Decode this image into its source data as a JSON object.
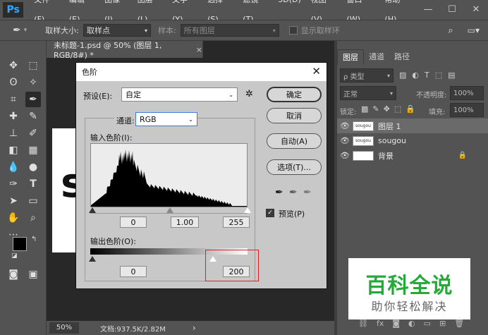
{
  "app": {
    "logo": "Ps"
  },
  "menu": [
    "文件(F)",
    "编辑(E)",
    "图像(I)",
    "图层(L)",
    "文字(Y)",
    "选择(S)",
    "滤镜(T)",
    "3D(D)",
    "视图(V)",
    "窗口(W)",
    "帮助(H)"
  ],
  "window_controls": {
    "minimize": "—",
    "maximize": "☐",
    "close": "✕"
  },
  "options": {
    "sample_size_label": "取样大小:",
    "sample_size_value": "取样点",
    "sample_label": "样本:",
    "sample_value": "所有图层",
    "show_ring_label": "显示取样环"
  },
  "document": {
    "tab_title": "未标题-1.psd @ 50% (图层 1, RGB/8#) *",
    "tab_close": "×",
    "canvas_letter": "s"
  },
  "status": {
    "zoom": "50%",
    "doc_info": "文档:937.5K/2.82M",
    "arrow": "›"
  },
  "panels": {
    "tabs": [
      "图层",
      "通道",
      "路径"
    ],
    "kind_label": "ρ 类型",
    "blend_mode": "正常",
    "opacity_label": "不透明度:",
    "opacity_value": "100%",
    "lock_label": "锁定:",
    "fill_label": "填充:",
    "fill_value": "100%",
    "layers": [
      {
        "name": "图层 1",
        "selected": true,
        "thumb": "sougou"
      },
      {
        "name": "sougou",
        "selected": false,
        "thumb": "sougou"
      },
      {
        "name": "背景",
        "selected": false,
        "thumb": ""
      }
    ],
    "lock_icon": "🔒"
  },
  "watermark": {
    "line1": "百科全说",
    "line2": "助你轻松解决"
  },
  "levels_dialog": {
    "title": "色阶",
    "preset_label": "预设(E):",
    "preset_value": "自定",
    "channel_label": "通道:",
    "channel_value": "RGB",
    "input_label": "输入色阶(I):",
    "output_label": "输出色阶(O):",
    "input_black": "0",
    "input_gamma": "1.00",
    "input_white": "255",
    "output_black": "0",
    "output_white": "200",
    "buttons": {
      "ok": "确定",
      "cancel": "取消",
      "auto": "自动(A)",
      "options": "选项(T)..."
    },
    "preview_label": "预览(P)",
    "preview_checked": true,
    "output_white_fraction": 0.78
  },
  "colors": {
    "accent": "#31a8ff",
    "watermark_green": "#25a93a",
    "highlight": "#e02020"
  }
}
